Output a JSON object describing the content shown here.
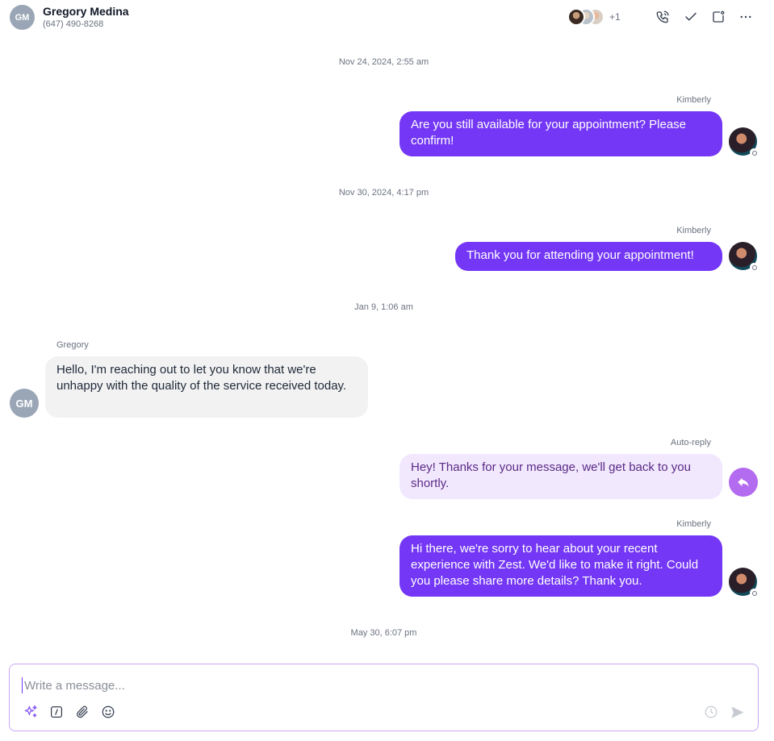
{
  "contact": {
    "initials": "GM",
    "name": "Gregory Medina",
    "phone": "(647) 490-8268"
  },
  "participants": {
    "more": "+1"
  },
  "colors": {
    "outgoing": "#7337f5",
    "incoming": "#f2f2f3",
    "auto_reply": "#f1e8fd",
    "accent": "#b36bf0"
  },
  "messages": [
    {
      "timestamp": "Nov 24, 2024, 2:55 am",
      "sender": "Kimberly",
      "text": "Are you still available for your appointment? Please confirm!"
    },
    {
      "timestamp": "Nov 30, 2024, 4:17 pm",
      "sender": "Kimberly",
      "text": "Thank you for attending your appointment!"
    },
    {
      "timestamp": "Jan 9, 1:06 am",
      "sender": "Gregory",
      "initials": "GM",
      "text": "Hello, I'm reaching out to let you know that we're unhappy with the quality of the service received today."
    },
    {
      "sender": "Auto-reply",
      "text": "Hey! Thanks for your message, we'll get back to you shortly."
    },
    {
      "sender": "Kimberly",
      "text": "Hi there, we're sorry to hear about your recent experience with Zest. We'd like to make it right. Could you please share more details? Thank you."
    }
  ],
  "last_timestamp": "May 30, 6:07 pm",
  "composer": {
    "placeholder": "Write a message..."
  }
}
